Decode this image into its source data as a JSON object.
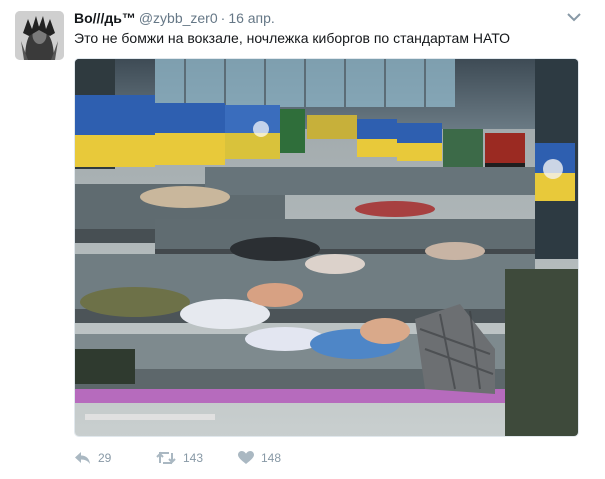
{
  "tweet": {
    "display_name": "Во///дь™",
    "handle": "@zybb_zer0",
    "separator": "·",
    "date": "16 апр.",
    "text": "Это не бомжи на вокзале, ночлежка киборгов по стандартам НАТО"
  },
  "actions": {
    "reply_count": "29",
    "retweet_count": "143",
    "like_count": "148"
  },
  "icons": {
    "reply": "reply-icon",
    "retweet": "retweet-icon",
    "like": "heart-icon",
    "menu": "chevron-down-icon"
  },
  "colors": {
    "text": "#14171a",
    "muted": "#657786",
    "action": "#8899a6",
    "flag_blue": "#2e5fb0",
    "flag_yellow": "#e8c93a"
  }
}
